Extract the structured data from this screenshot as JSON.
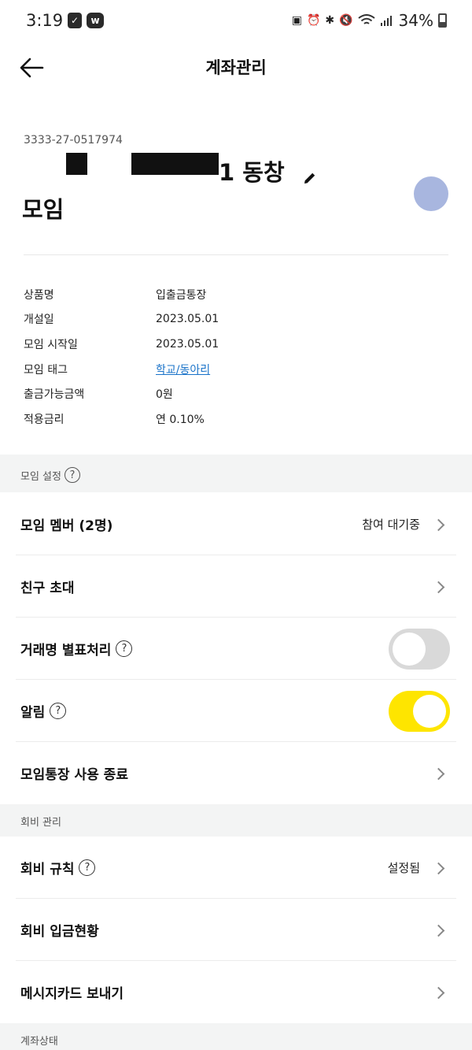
{
  "status_bar": {
    "time": "3:19",
    "battery": "34%",
    "left_icons": [
      "checkbox-icon",
      "w-app-icon"
    ],
    "right_icons": [
      "lock-screen-icon",
      "alarm-icon",
      "bluetooth-icon",
      "mute-icon",
      "wifi-icon",
      "signal-icon",
      "battery-icon"
    ]
  },
  "header": {
    "title": "계좌관리",
    "back_icon": "arrow-left-icon"
  },
  "account": {
    "number": "3333-27-0517974",
    "name_visible_part": "1 동창",
    "name_line2": "모임",
    "edit_icon": "pencil-icon"
  },
  "info": [
    {
      "label": "상품명",
      "value": "입출금통장"
    },
    {
      "label": "개설일",
      "value": "2023.05.01"
    },
    {
      "label": "모임 시작일",
      "value": "2023.05.01"
    },
    {
      "label": "모임 태그",
      "value": "학교/동아리"
    },
    {
      "label": "출금가능금액",
      "value": "0원"
    },
    {
      "label": "적용금리",
      "value": "연 0.10%"
    }
  ],
  "sections": {
    "group_settings": "모임 설정",
    "dues_management": "회비 관리",
    "account_status": "계좌상태"
  },
  "menu": {
    "members": {
      "label": "모임 멤버 (2명)",
      "status": "참여 대기중"
    },
    "invite": {
      "label": "친구 초대"
    },
    "mask_names": {
      "label": "거래명 별표처리",
      "enabled": false
    },
    "notifications": {
      "label": "알림",
      "enabled": true
    },
    "end_usage": {
      "label": "모임통장 사용 종료"
    },
    "dues_rules": {
      "label": "회비 규칙",
      "status": "설정됨"
    },
    "dues_status": {
      "label": "회비 입금현황"
    },
    "message_card": {
      "label": "메시지카드 보내기"
    }
  },
  "colors": {
    "toggle_on": "#fee500",
    "toggle_off": "#d9d9d9",
    "link": "#1a73c9",
    "avatar": "#a8b6df"
  }
}
